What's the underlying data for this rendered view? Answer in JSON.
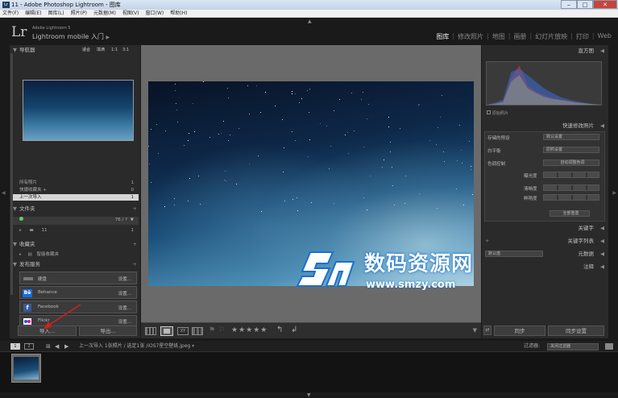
{
  "window": {
    "title": "11 - Adobe Photoshop Lightroom - 图库",
    "min": "‒",
    "max": "□",
    "close": "✕",
    "icon_text": "Lr"
  },
  "menubar": [
    "文件(F)",
    "编辑(E)",
    "图库(L)",
    "照片(P)",
    "元数据(M)",
    "视图(V)",
    "窗口(W)",
    "帮助(H)"
  ],
  "identity": {
    "logo": "Lr",
    "product": "Adobe Lightroom 5",
    "mobile": "Lightroom mobile 入门"
  },
  "modules": [
    "图库",
    "修改照片",
    "地图",
    "画册",
    "幻灯片放映",
    "打印",
    "Web"
  ],
  "left": {
    "navigator": {
      "title": "导航器",
      "zoom_options": [
        "适合",
        "填满",
        "1:1",
        "3:1"
      ]
    },
    "catalog": {
      "items": [
        {
          "label": "所有照片",
          "count": "1"
        },
        {
          "label": "快捷收藏夹 +",
          "count": "0"
        },
        {
          "label": "上一次导入",
          "count": "1"
        }
      ]
    },
    "folders": {
      "title": "文件夹",
      "volume_count": "76 / ?",
      "folder": "11",
      "folder_count": "1"
    },
    "collections": {
      "title": "收藏夹",
      "item": "智能收藏夹"
    },
    "publish": {
      "title": "发布服务",
      "services": [
        {
          "name": "硬盘",
          "action": "设置..."
        },
        {
          "name": "Behance",
          "action": "设置..."
        },
        {
          "name": "Facebook",
          "action": "设置..."
        },
        {
          "name": "Flickr",
          "action": "设置..."
        }
      ]
    },
    "import_label": "导入...",
    "export_label": "导出..."
  },
  "right": {
    "histogram": {
      "title": "直方图",
      "original_label": "原始照片"
    },
    "quick_develop": {
      "title": "快速修改照片",
      "saved_preset_label": "存储的预设",
      "saved_preset_value": "默认设置",
      "wb_label": "白平衡",
      "wb_value": "原照设置",
      "tone_label": "色调控制",
      "tone_value": "自动调整色调",
      "exposure_label": "曝光度",
      "clarity_label": "清晰度",
      "vibrance_label": "鲜艳度",
      "reset_label": "全部重置"
    },
    "keywording": "关键字",
    "keyword_list": "关键字列表",
    "metadata": {
      "title": "元数据",
      "value": "默认值"
    },
    "comments": "注释",
    "sync_label": "同步",
    "sync_settings_label": "同步设置"
  },
  "filmstrip": {
    "page1": "1",
    "page2": "2",
    "breadcrumb": "上一次导入  1张照片 / 选定1张 /iOS7星空壁纸.jpeg",
    "filter_label": "过滤器:",
    "filter_value": "关闭过滤器"
  },
  "watermark": {
    "cn": "数码资源网",
    "url": "www.smzy.com"
  },
  "chart_data": {
    "type": "area",
    "series": [
      {
        "values": [
          0,
          2,
          5,
          40,
          60,
          30,
          20,
          15,
          10,
          8,
          6,
          4,
          2,
          1,
          0
        ]
      },
      {
        "values": [
          0,
          1,
          4,
          35,
          45,
          25,
          18,
          12,
          9,
          7,
          5,
          3,
          2,
          1,
          0
        ]
      },
      {
        "values": [
          0,
          3,
          8,
          50,
          55,
          45,
          35,
          25,
          18,
          12,
          8,
          5,
          3,
          1,
          0
        ]
      }
    ],
    "colors": [
      "#e0322a",
      "#e4d827",
      "#3a6bd6"
    ]
  }
}
